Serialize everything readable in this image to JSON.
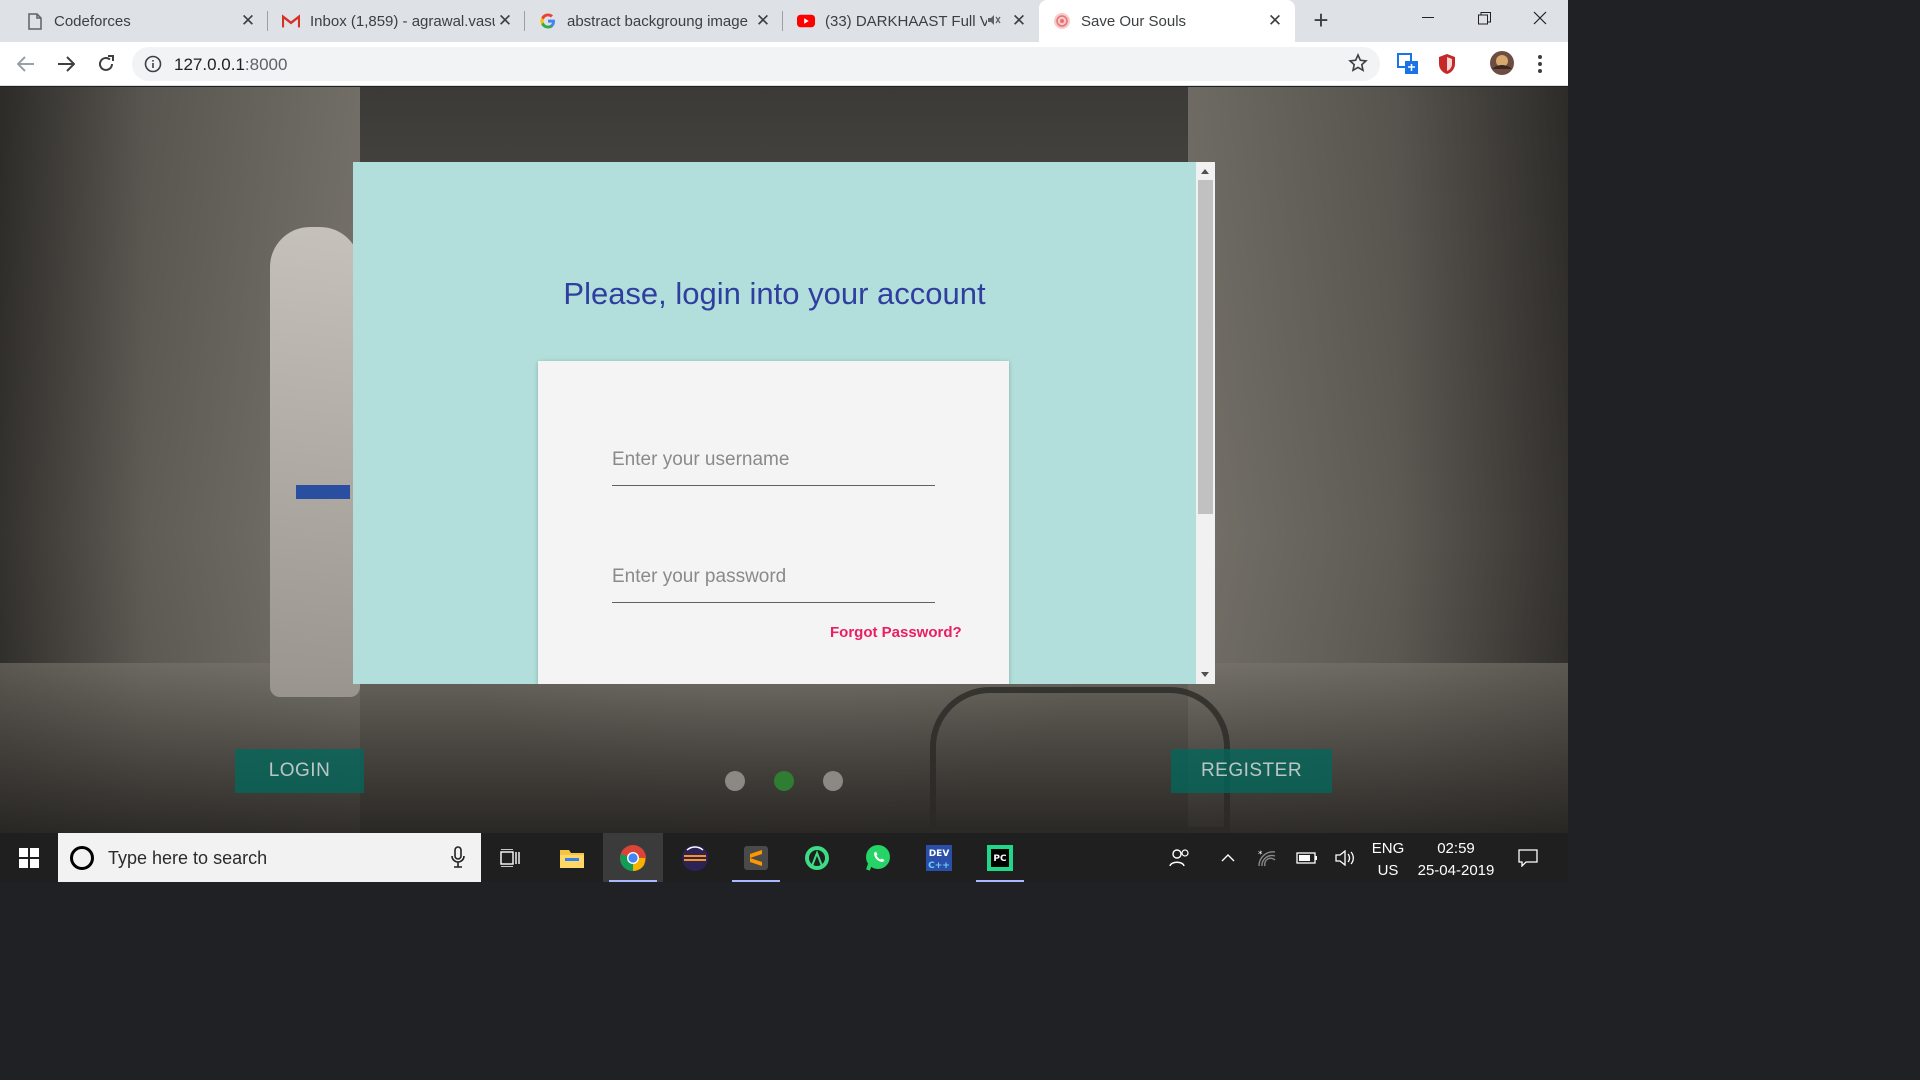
{
  "browser": {
    "tabs": [
      {
        "title": "Codeforces",
        "icon": "document-icon"
      },
      {
        "title": "Inbox (1,859) - agrawal.vasu",
        "icon": "gmail-icon"
      },
      {
        "title": "abstract backgroung image",
        "icon": "google-icon"
      },
      {
        "title": "(33) DARKHAAST Full V",
        "icon": "youtube-icon"
      },
      {
        "title": "Save Our Souls",
        "icon": "site-icon"
      }
    ],
    "active_tab": 4,
    "url_host": "127.0.0.1",
    "url_port": ":8000"
  },
  "modal": {
    "title": "Please, login into your account",
    "username_placeholder": "Enter your username",
    "password_placeholder": "Enter your password",
    "forgot_link": "Forgot Password?"
  },
  "page": {
    "login_button": "LOGIN",
    "register_button": "REGISTER",
    "carousel": {
      "count": 3,
      "active": 1
    }
  },
  "taskbar": {
    "search_placeholder": "Type here to search",
    "lang_line1": "ENG",
    "lang_line2": "US",
    "time": "02:59",
    "date": "25-04-2019"
  },
  "colors": {
    "modal_bg": "#b2dfdb",
    "title_color": "#303f9f",
    "forgot_color": "#e91e63",
    "button_color": "#00695c",
    "active_dot": "#2e7d32"
  }
}
